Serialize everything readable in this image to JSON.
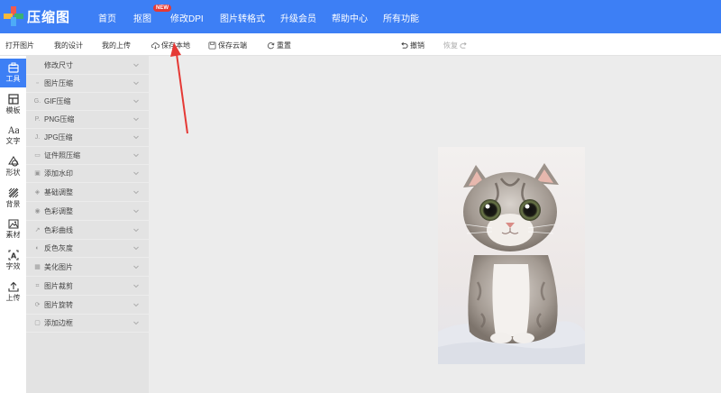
{
  "app": {
    "logo_text": "压缩图"
  },
  "nav": {
    "items": [
      "首页",
      "抠图",
      "修改DPI",
      "图片转格式",
      "升级会员",
      "帮助中心",
      "所有功能"
    ],
    "badge": "NEW"
  },
  "toolbar": {
    "open": "打开图片",
    "my_designs": "我的设计",
    "my_uploads": "我的上传",
    "save_local": "保存本地",
    "save_cloud": "保存云端",
    "reset": "重置",
    "undo": "撤销",
    "redo": "恢复"
  },
  "rail": {
    "items": [
      "工具",
      "模板",
      "文字",
      "形状",
      "背景",
      "素材",
      "字效",
      "上传"
    ],
    "active": "工具"
  },
  "panel": {
    "items": [
      {
        "label": "修改尺寸",
        "icon": ""
      },
      {
        "label": "图片压缩",
        "icon": "image-icon"
      },
      {
        "label": "GIF压缩",
        "icon": "gif-icon"
      },
      {
        "label": "PNG压缩",
        "icon": "png-icon"
      },
      {
        "label": "JPG压缩",
        "icon": "jpg-icon"
      },
      {
        "label": "证件照压缩",
        "icon": "id-photo-icon"
      },
      {
        "label": "添加水印",
        "icon": "watermark-icon"
      },
      {
        "label": "基础调整",
        "icon": "adjust-icon"
      },
      {
        "label": "色彩调整",
        "icon": "eye-icon"
      },
      {
        "label": "色彩曲线",
        "icon": "curve-icon"
      },
      {
        "label": "反色灰度",
        "icon": "invert-icon"
      },
      {
        "label": "美化图片",
        "icon": "beautify-icon"
      },
      {
        "label": "图片裁剪",
        "icon": "crop-icon"
      },
      {
        "label": "图片旋转",
        "icon": "rotate-icon"
      },
      {
        "label": "添加边框",
        "icon": "border-icon"
      }
    ]
  },
  "colors": {
    "brand": "#3d7ff5",
    "badge": "#e53935",
    "annotation_arrow": "#e53935"
  }
}
